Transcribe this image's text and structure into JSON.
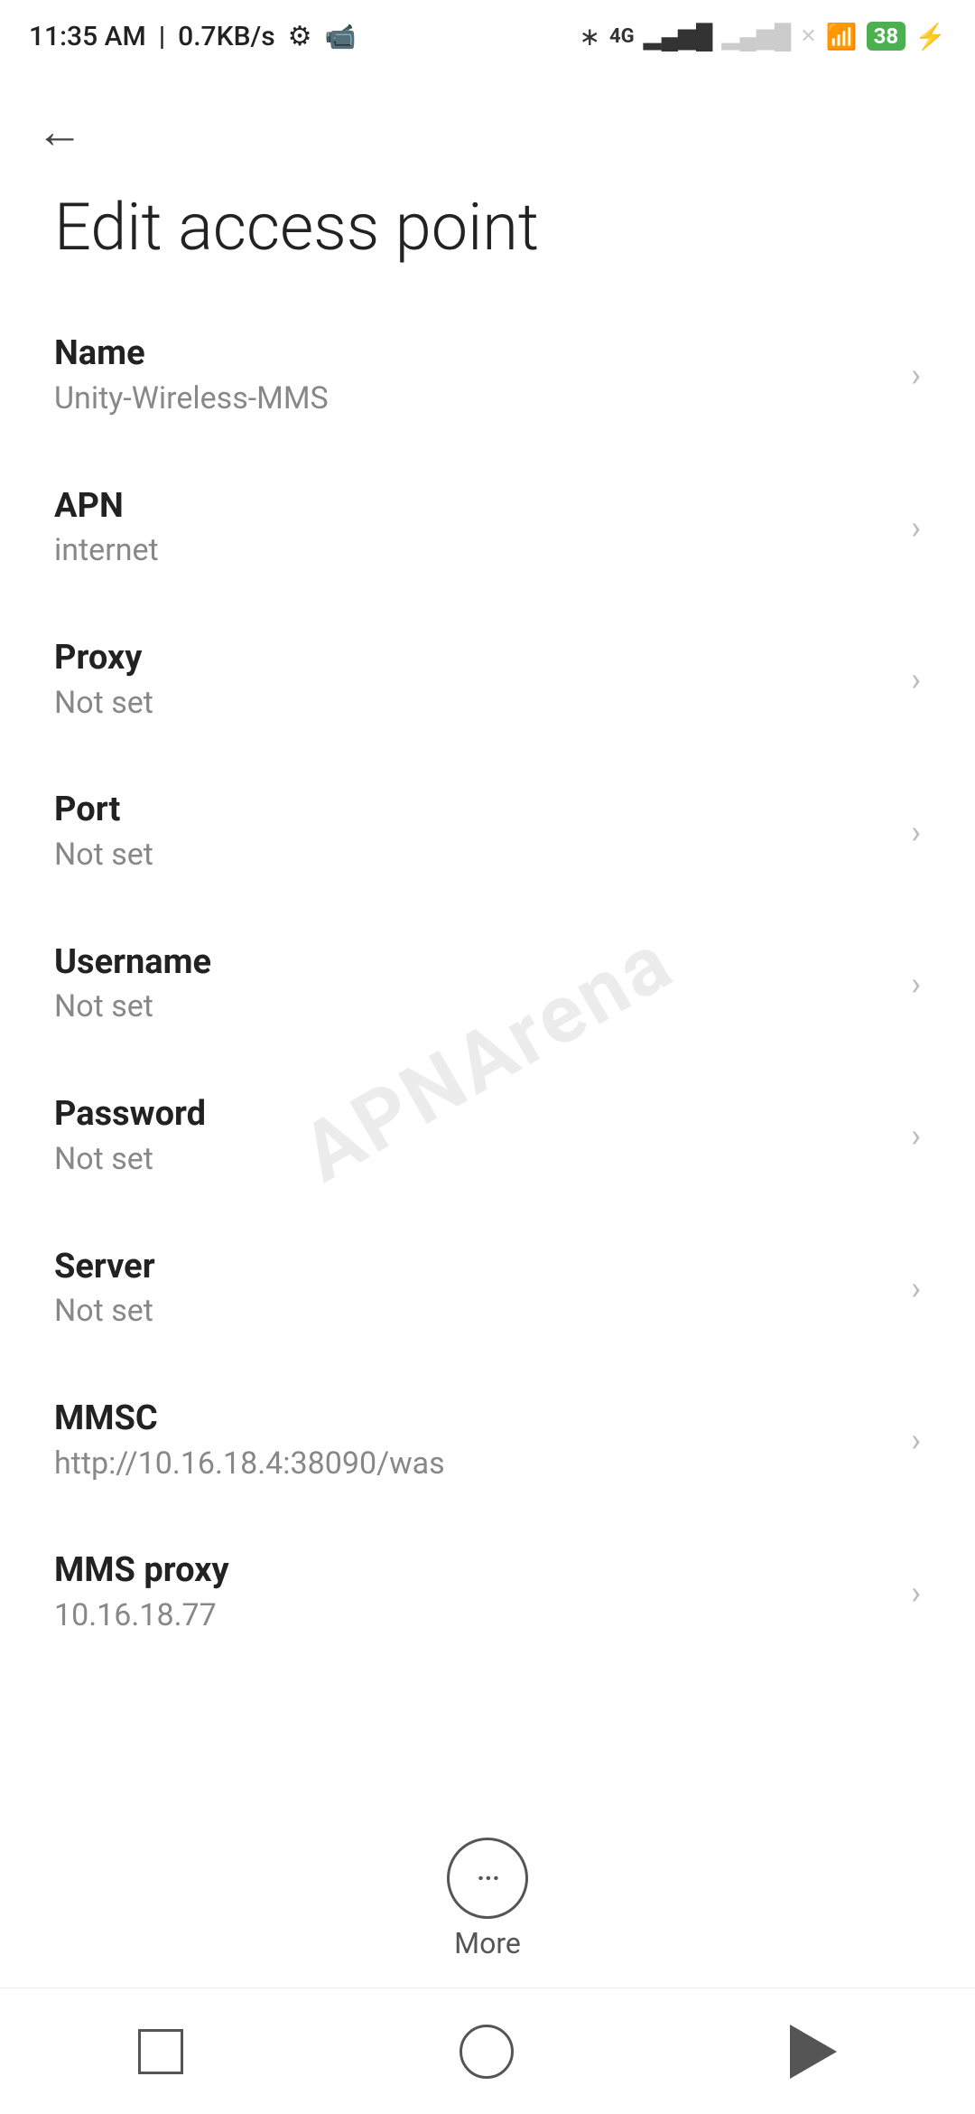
{
  "status_bar": {
    "time": "11:35 AM",
    "speed": "0.7KB/s"
  },
  "header": {
    "back_label": "←",
    "title": "Edit access point"
  },
  "settings_items": [
    {
      "label": "Name",
      "value": "Unity-Wireless-MMS"
    },
    {
      "label": "APN",
      "value": "internet"
    },
    {
      "label": "Proxy",
      "value": "Not set"
    },
    {
      "label": "Port",
      "value": "Not set"
    },
    {
      "label": "Username",
      "value": "Not set"
    },
    {
      "label": "Password",
      "value": "Not set"
    },
    {
      "label": "Server",
      "value": "Not set"
    },
    {
      "label": "MMSC",
      "value": "http://10.16.18.4:38090/was"
    },
    {
      "label": "MMS proxy",
      "value": "10.16.18.77"
    }
  ],
  "more_button": {
    "label": "More",
    "icon": "···"
  },
  "watermark": {
    "text": "APNArena"
  }
}
